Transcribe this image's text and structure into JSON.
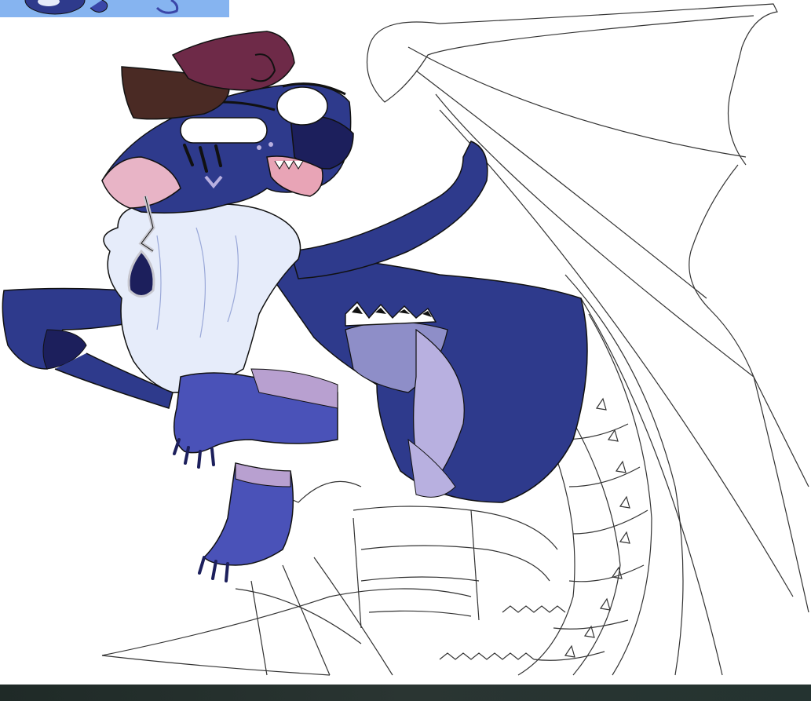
{
  "colors": {
    "background": "#ffffff",
    "body_blue": "#2e3a8c",
    "body_blue_mid": "#3a46a8",
    "limb_blue": "#4a52b8",
    "dark_navy": "#1c1f5c",
    "fur_white": "#e6ecfa",
    "lavender": "#b8b0e0",
    "pink": "#e8b4c6",
    "hat_brown": "#4a2a24",
    "hat_maroon": "#6e2a48",
    "earring_silver": "#c8c8d0",
    "reference_strip": "#86b4f0",
    "bottom_bar": "#233130"
  },
  "icons": {
    "reference_strip": "character-reference-icon",
    "artwork": "dragon-creature-drawing"
  }
}
